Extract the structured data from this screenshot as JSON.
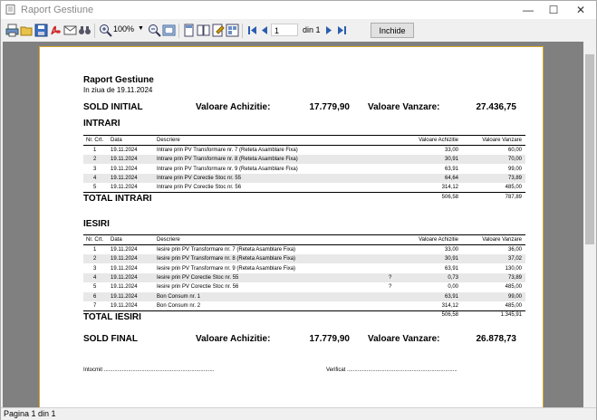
{
  "window": {
    "title": "Raport Gestiune",
    "minimize": "—",
    "maximize": "☐",
    "close": "✕"
  },
  "toolbar": {
    "zoom": "100%",
    "page_current": "1",
    "page_of_label": "din 1",
    "close_label": "Inchide"
  },
  "status": {
    "text": "Pagina 1 din 1"
  },
  "report": {
    "title": "Raport Gestiune",
    "date_line": "In ziua de 19.11.2024",
    "sold_initial": {
      "label": "SOLD INITIAL",
      "achizitie_label": "Valoare Achizitie:",
      "achizitie": "17.779,90",
      "vanzare_label": "Valoare Vanzare:",
      "vanzare": "27.436,75"
    },
    "headers": {
      "nr": "Nr. Crt.",
      "data": "Data",
      "descriere": "Descriere",
      "achizitie": "Valoare Achizitie",
      "vanzare": "Valoare Vanzare"
    },
    "intrari": {
      "title": "INTRARI",
      "rows": [
        {
          "nr": "1",
          "data": "19.11.2024",
          "descriere": "Intrare prin PV Transformare nr. 7 (Reteta Asamblare Fixa)",
          "flag": "",
          "achizitie": "33,00",
          "vanzare": "60,00"
        },
        {
          "nr": "2",
          "data": "19.11.2024",
          "descriere": "Intrare prin PV Transformare nr. 8 (Reteta Asamblare Fixa)",
          "flag": "",
          "achizitie": "30,91",
          "vanzare": "70,00"
        },
        {
          "nr": "3",
          "data": "19.11.2024",
          "descriere": "Intrare prin PV Transformare nr. 9 (Reteta Asamblare Fixa)",
          "flag": "",
          "achizitie": "63,91",
          "vanzare": "99,00"
        },
        {
          "nr": "4",
          "data": "19.11.2024",
          "descriere": "Intrare prin PV Corectie Stoc nr. 55",
          "flag": "",
          "achizitie": "64,64",
          "vanzare": "73,89"
        },
        {
          "nr": "5",
          "data": "19.11.2024",
          "descriere": "Intrare prin PV Corectie Stoc nr. 56",
          "flag": "",
          "achizitie": "314,12",
          "vanzare": "485,00"
        }
      ],
      "total_label": "TOTAL  INTRARI",
      "total_achizitie": "506,58",
      "total_vanzare": "787,89"
    },
    "iesiri": {
      "title": "IESIRI",
      "rows": [
        {
          "nr": "1",
          "data": "19.11.2024",
          "descriere": "Iesire prin PV Transformare nr. 7 (Reteta Asamblare Fixa)",
          "flag": "",
          "achizitie": "33,00",
          "vanzare": "36,00"
        },
        {
          "nr": "2",
          "data": "19.11.2024",
          "descriere": "Iesire prin PV Transformare nr. 8 (Reteta Asamblare Fixa)",
          "flag": "",
          "achizitie": "30,91",
          "vanzare": "37,02"
        },
        {
          "nr": "3",
          "data": "19.11.2024",
          "descriere": "Iesire prin PV Transformare nr. 9 (Reteta Asamblare Fixa)",
          "flag": "",
          "achizitie": "63,91",
          "vanzare": "130,00"
        },
        {
          "nr": "4",
          "data": "19.11.2024",
          "descriere": "Iesire prin PV Corectie Stoc nr. 55",
          "flag": "?",
          "achizitie": "0,73",
          "vanzare": "73,89"
        },
        {
          "nr": "5",
          "data": "19.11.2024",
          "descriere": "Iesire prin PV Corectie Stoc nr. 56",
          "flag": "?",
          "achizitie": "0,00",
          "vanzare": "485,00"
        },
        {
          "nr": "6",
          "data": "19.11.2024",
          "descriere": "Bon Consum nr. 1",
          "flag": "",
          "achizitie": "63,91",
          "vanzare": "99,00"
        },
        {
          "nr": "7",
          "data": "19.11.2024",
          "descriere": "Bon Consum nr. 2",
          "flag": "",
          "achizitie": "314,12",
          "vanzare": "485,00"
        }
      ],
      "total_label": "TOTAL  IESIRI",
      "total_achizitie": "506,58",
      "total_vanzare": "1.345,91"
    },
    "sold_final": {
      "label": "SOLD FINAL",
      "achizitie_label": "Valoare Achizitie:",
      "achizitie": "17.779,90",
      "vanzare_label": "Valoare Vanzare:",
      "vanzare": "26.878,73"
    },
    "intocmit": "Intocmit .........................................................................",
    "verificat": "Verificat ........................................................................."
  }
}
